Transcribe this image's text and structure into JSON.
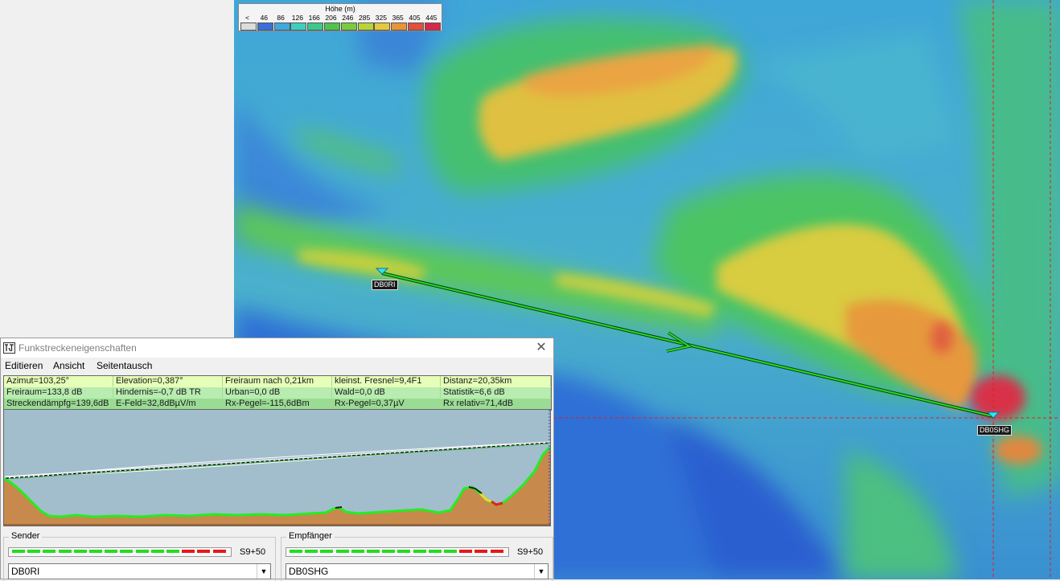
{
  "legend": {
    "title": "Höhe (m)",
    "labels": [
      "<",
      "46",
      "86",
      "126",
      "166",
      "206",
      "246",
      "285",
      "325",
      "365",
      "405",
      "445"
    ],
    "colors": [
      "#dcdcdc",
      "#3b6fd8",
      "#3fa8e0",
      "#3ecfc0",
      "#3cc88a",
      "#4ec44c",
      "#7acc3e",
      "#b8d438",
      "#e6c840",
      "#e8943c",
      "#e0503c",
      "#d82848"
    ]
  },
  "map": {
    "stations": [
      {
        "name": "DB0RI"
      },
      {
        "name": "DB0SHG"
      }
    ]
  },
  "dialog": {
    "title": "Funkstreckeneigenschaften",
    "close": "✕",
    "menu": [
      "Editieren",
      "Ansicht",
      "Seitentausch"
    ],
    "stats": [
      [
        "Azimut=103,25°",
        "Elevation=0,387°",
        "Freiraum nach 0,21km",
        "kleinst. Fresnel=9,4F1",
        "Distanz=20,35km"
      ],
      [
        "Freiraum=133,8 dB",
        "Hindernis=-0,7 dB TR",
        "Urban=0,0 dB",
        "Wald=0,0 dB",
        "Statistik=6,6 dB"
      ],
      [
        "Streckendämpfg=139,6dB",
        "E-Feld=32,8dBµV/m",
        "Rx-Pegel=-115,6dBm",
        "Rx-Pegel=0,37µV",
        "Rx relativ=71,4dB"
      ]
    ],
    "sender": {
      "label": "Sender",
      "level": "S9+50",
      "station": "DB0RI"
    },
    "receiver": {
      "label": "Empfänger",
      "level": "S9+50",
      "station": "DB0SHG"
    }
  },
  "colors": {
    "meter_green": "#22dd22",
    "meter_red": "#e81818",
    "link_line": "#22cc22",
    "terrain_brown": "#c8884a"
  }
}
